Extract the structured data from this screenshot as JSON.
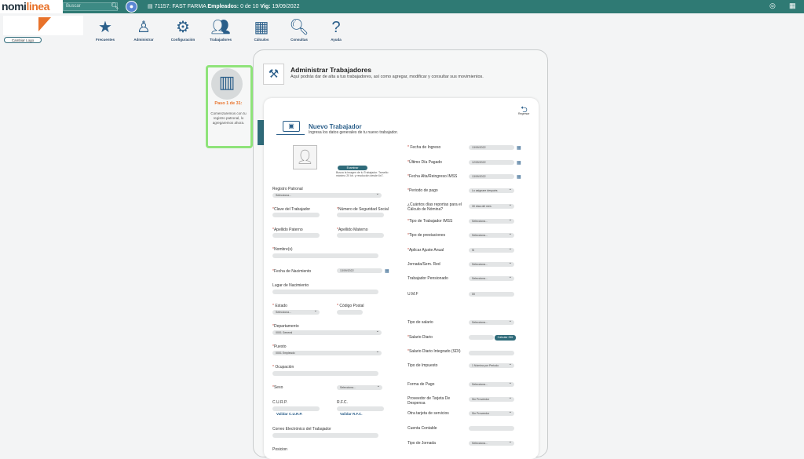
{
  "topbar": {
    "logo_main": "nomi",
    "logo_accent": "linea",
    "search_placeholder": "Buscar",
    "company_id": "71157: FAST FARMA",
    "employees_label": "Empleados:",
    "employees_value": "0 de 10",
    "vig_label": "Vig:",
    "vig_value": "19/09/2022"
  },
  "logo_area": {
    "change_logo": "Cambiar Logo"
  },
  "toolbar": [
    {
      "label": "Frecuentes",
      "icon": "star-icon"
    },
    {
      "label": "Administrar",
      "icon": "tie-icon"
    },
    {
      "label": "Configuración",
      "icon": "gear-icon"
    },
    {
      "label": "Trabajadores",
      "icon": "workers-icon"
    },
    {
      "label": "Cálculos",
      "icon": "calculator-icon"
    },
    {
      "label": "Consultas",
      "icon": "search-icon"
    },
    {
      "label": "Ayuda",
      "icon": "question-icon"
    }
  ],
  "step": {
    "title": "Paso 1 de 31:",
    "desc": "Comenzaremos con tu registro patronal, lo agregaremos ahora."
  },
  "admin": {
    "title": "Administrar Trabajadores",
    "subtitle": "Aquí podrás dar de alta a tus trabajadores, así como agregar, modificar y consultar sus movimientos."
  },
  "card": {
    "back_label": "Regresar",
    "title": "Nuevo Trabajador",
    "subtitle": "Ingresa los datos generales de tu nuevo trabajador.",
    "browse_button": "Examinar",
    "browse_help": "Busca la imagen de tu Trabajador. Tamaño máximo 20 kb. y resolución desde 6x7."
  },
  "left_form": {
    "registro_patronal": "Registro Patronal",
    "registro_patronal_value": "Selecciona...",
    "clave": "Clave del Trabajador",
    "nss": "Número de Seguridad Social",
    "apellido_paterno": "Apellido Paterno",
    "apellido_materno": "Apellido Materno",
    "nombre": "Nombre(s)",
    "fecha_nacimiento": "Fecha de Nacimiento",
    "fecha_nacimiento_value": "13/09/2022",
    "lugar_nacimiento": "Lugar de Nacimiento",
    "estado": "Estado",
    "estado_value": "Selecciona...",
    "codigo_postal": "Código Postal",
    "departamento": "Departamento",
    "departamento_value": "0001 General",
    "puesto": "Puesto",
    "puesto_value": "0001 Empleado",
    "ocupacion": "Ocupación",
    "sexo": "Sexo",
    "sexo_value": "Selecciona...",
    "curp": "C.U.R.P.",
    "rfc": "R.F.C.",
    "validar_curp": "Validar C.U.R.P.",
    "validar_rfc": "Validar R.F.C.",
    "correo": "Correo Electrónico del Trabajador",
    "posicion": "Posicion"
  },
  "right_form": {
    "fecha_ingreso": "Fecha de Ingreso",
    "fecha_ingreso_value": "13/09/2022",
    "ultimo_dia": "Último Día Pagado",
    "ultimo_dia_value": "12/09/2022",
    "fecha_alta": "Fecha Alta/Reingreso IMSS",
    "fecha_alta_value": "13/09/2022",
    "periodo_pago": "Periodo de pago",
    "periodo_pago_value": "Lo asignare después",
    "dias_reporta": "¿Cuántos días reportas para el Cálculo de Nómina?",
    "dias_reporta_value": "30 días del mes",
    "tipo_trabajador": "Tipo de Trabajador IMSS",
    "tipo_trabajador_value": "Selecciona...",
    "tipo_prestaciones": "Tipo de prestaciones",
    "tipo_prestaciones_value": "Selecciona...",
    "ajuste_anual": "Aplicar Ajuste Anual",
    "ajuste_anual_value": "Si",
    "jornada": "Jornada/Sem. Red",
    "jornada_value": "Selecciona...",
    "pensionado": "Trabajador Pensionado",
    "pensionado_value": "Selecciona...",
    "umf": "U.M.F",
    "umf_value": "00",
    "tipo_salario": "Tipo de salario",
    "tipo_salario_value": "Selecciona...",
    "salario_diario": "Salario Diario",
    "calcular_sdi": "Calcular SDI",
    "sdi": "Salario Diario Integrado (SDI)",
    "tipo_impuesto": "Tipo de Impuesto",
    "tipo_impuesto_value": "1 Nómina por Periodo",
    "forma_pago": "Forma de Pago",
    "forma_pago_value": "Selecciona...",
    "proveedor": "Proveedor de Tarjeta De Despensa",
    "proveedor_value": "Sin Proveedor",
    "otra_tarjeta": "Otra tarjeta de servicios",
    "otra_tarjeta_value": "Sin Proveedor",
    "cuenta_contable": "Cuenta Contable",
    "tipo_jornada": "Tipo de Jornada",
    "tipo_jornada_value": "Selecciona..."
  }
}
